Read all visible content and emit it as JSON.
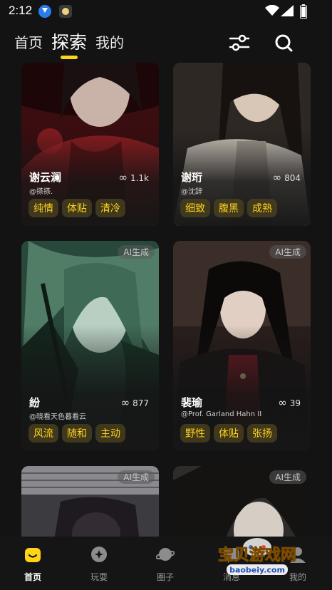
{
  "status_bar": {
    "time": "2:12"
  },
  "top_nav": {
    "tabs": [
      {
        "label": "首页"
      },
      {
        "label": "探索"
      },
      {
        "label": "我的"
      }
    ]
  },
  "cards": [
    {
      "name": "谢云澜",
      "author": "@搽搽.",
      "count": "1.1k",
      "tags": [
        "纯情",
        "体贴",
        "清冷"
      ],
      "ai_badge": ""
    },
    {
      "name": "谢珩",
      "author": "@沈辞",
      "count": "804",
      "tags": [
        "细致",
        "腹黑",
        "成熟"
      ],
      "ai_badge": ""
    },
    {
      "name": "紛",
      "author": "@晓看天色暮看云",
      "count": "877",
      "tags": [
        "风流",
        "随和",
        "主动"
      ],
      "ai_badge": "AI生成"
    },
    {
      "name": "裴瑜",
      "author": "@Prof. Garland Hahn II",
      "count": "39",
      "tags": [
        "野性",
        "体贴",
        "张扬"
      ],
      "ai_badge": "AI生成"
    },
    {
      "ai_badge": "AI生成"
    },
    {
      "ai_badge": "AI生成"
    }
  ],
  "bottom_nav": [
    {
      "label": "首页"
    },
    {
      "label": "玩耍"
    },
    {
      "label": "圈子"
    },
    {
      "label": "消息"
    },
    {
      "label": "我的"
    }
  ],
  "watermark": {
    "title": "宝贝游戏网",
    "url": "baobeiy.com"
  },
  "colors": {
    "accent": "#ffd417",
    "background": "#131313",
    "tag_text": "#ffd21a"
  }
}
